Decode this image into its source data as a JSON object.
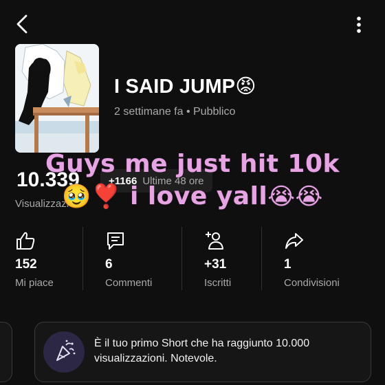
{
  "video": {
    "title": "I SAID JUMP",
    "title_emoji": "😡",
    "age": "2 settimane fa",
    "visibility": "Pubblico"
  },
  "views": {
    "count": "10.339",
    "delta": "+1166",
    "delta_period": "Ultime 48 ore",
    "label": "Visualizzazioni"
  },
  "overlay_caption": {
    "line1": "Guys me just hit 10k",
    "line2_prefix": "🥹❣️",
    "line2_text": " i love yall",
    "line2_suffix": "😭😭"
  },
  "stats": [
    {
      "icon": "thumbs-up-icon",
      "value": "152",
      "label": "Mi piace"
    },
    {
      "icon": "comment-icon",
      "value": "6",
      "label": "Commenti"
    },
    {
      "icon": "add-subscriber-icon",
      "value": "+31",
      "label": "Iscritti"
    },
    {
      "icon": "share-icon",
      "value": "1",
      "label": "Condivisioni"
    }
  ],
  "milestone_card": {
    "icon": "party-popper-icon",
    "message": "È il tuo primo Short che ha raggiunto 10.000 visualizzazioni. Notevole."
  },
  "colors": {
    "background": "#0f0f0f",
    "overlay_text": "#e7a4e4",
    "secondary_text": "#aaaaaa"
  }
}
